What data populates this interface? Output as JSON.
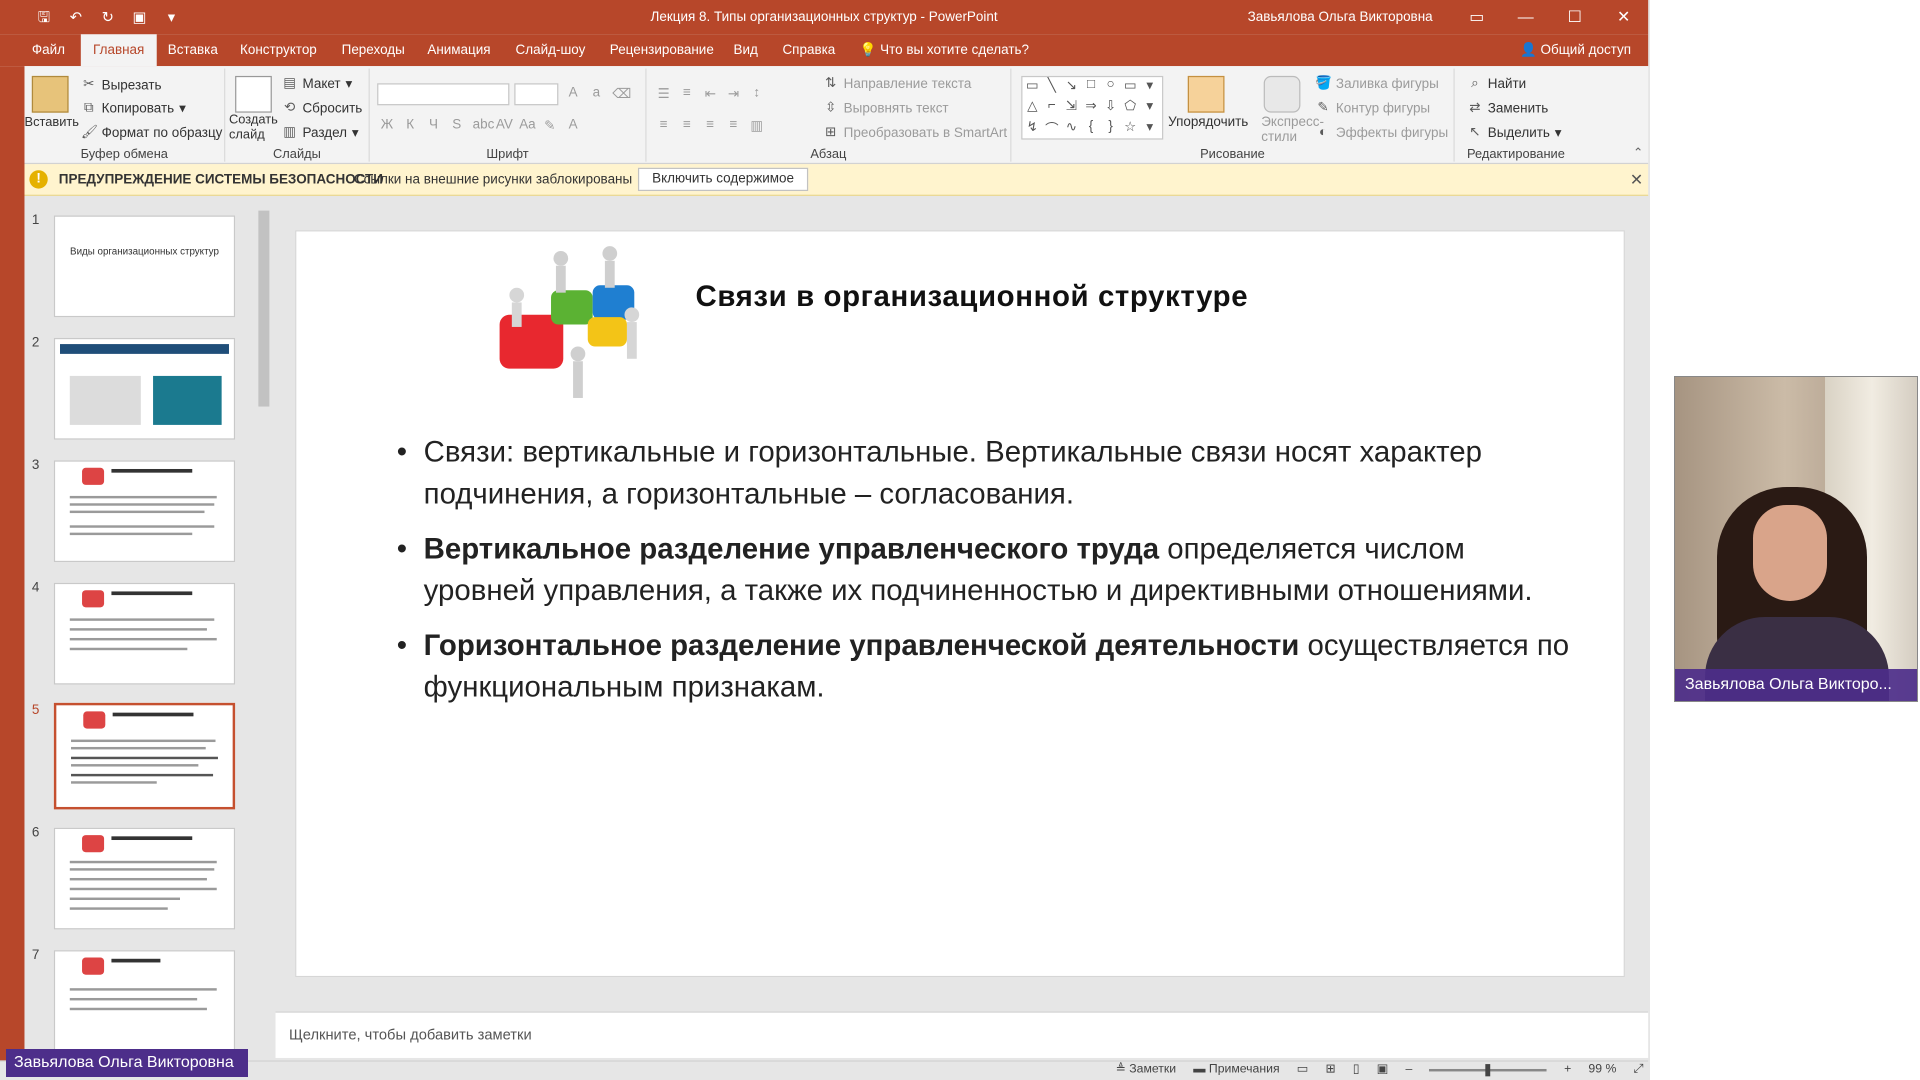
{
  "window": {
    "title": "Лекция 8. Типы организационных структур  -  PowerPoint",
    "user": "Завьялова Ольга Викторовна"
  },
  "tabs": [
    "Файл",
    "Главная",
    "Вставка",
    "Конструктор",
    "Переходы",
    "Анимация",
    "Слайд-шоу",
    "Рецензирование",
    "Вид",
    "Справка"
  ],
  "tell_me": "Что вы хотите сделать?",
  "share": "Общий доступ",
  "ribbon": {
    "clipboard": {
      "paste": "Вставить",
      "cut": "Вырезать",
      "copy": "Копировать",
      "format_painter": "Формат по образцу",
      "label": "Буфер обмена"
    },
    "slides": {
      "new_slide": "Создать слайд",
      "layout": "Макет",
      "reset": "Сбросить",
      "section": "Раздел",
      "label": "Слайды"
    },
    "font": {
      "label": "Шрифт"
    },
    "paragraph": {
      "text_direction": "Направление текста",
      "align_text": "Выровнять текст",
      "smartart": "Преобразовать в SmartArt",
      "label": "Абзац"
    },
    "drawing": {
      "arrange": "Упорядочить",
      "quick_styles": "Экспресс-стили",
      "fill": "Заливка фигуры",
      "outline": "Контур фигуры",
      "effects": "Эффекты фигуры",
      "label": "Рисование"
    },
    "editing": {
      "find": "Найти",
      "replace": "Заменить",
      "select": "Выделить",
      "label": "Редактирование"
    }
  },
  "security": {
    "title": "ПРЕДУПРЕЖДЕНИЕ СИСТЕМЫ БЕЗОПАСНОСТИ",
    "message": "Ссылки на внешние рисунки заблокированы",
    "button": "Включить содержимое"
  },
  "thumbnails": {
    "numbers": [
      "1",
      "2",
      "3",
      "4",
      "5",
      "6",
      "7"
    ],
    "slide1_title": "Виды организационных структур",
    "active_index": 5
  },
  "slide": {
    "title": "Связи в организационной структуре",
    "bullets": [
      {
        "bold": "",
        "text": "Связи: вертикальные и горизонтальные. Вертикальные связи носят характер подчинения, а горизонтальные – согласования."
      },
      {
        "bold": "Вертикальное разделение управленческого труда",
        "text": " определяется числом уровней управления, а также их подчиненностью и директивными отношениями."
      },
      {
        "bold": " Горизонтальное разделение управленческой деятельности",
        "text": " осуществляется по функциональным признакам."
      }
    ]
  },
  "notes_placeholder": "Щелкните, чтобы добавить заметки",
  "status": {
    "notes": "Заметки",
    "comments": "Примечания",
    "zoom": "99 %",
    "zoom_level": 0.99
  },
  "presenter": {
    "name_overlay": "Завьялова Ольга Викторовна",
    "webcam_name": "Завьялова Ольга Викторо..."
  },
  "colors": {
    "accent": "#b7472a",
    "security_bar": "#fff4ce",
    "presenter_label": "#4d2e8a"
  }
}
